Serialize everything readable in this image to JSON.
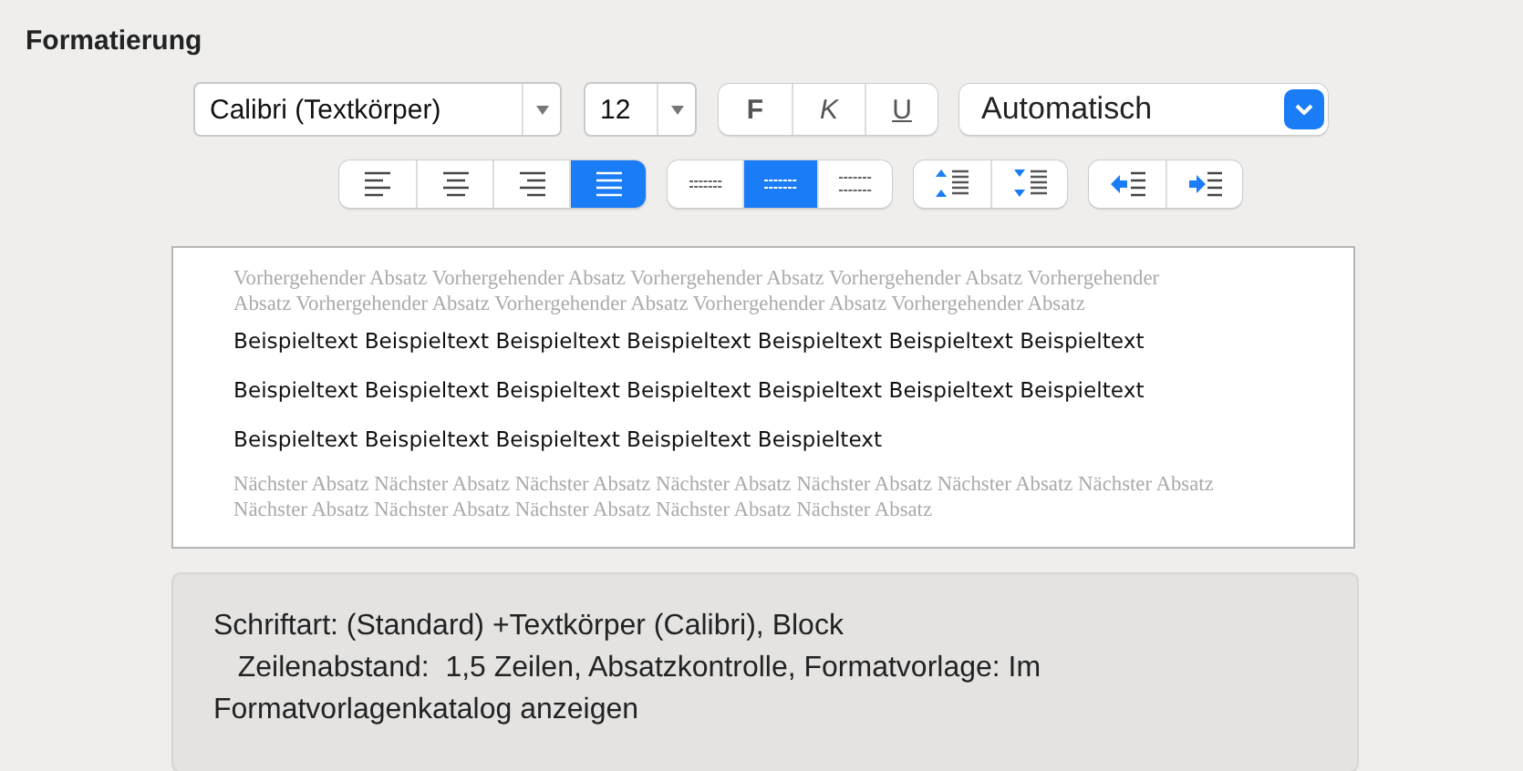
{
  "section_title": "Formatierung",
  "font_select": {
    "value": "Calibri (Textkörper)"
  },
  "size_select": {
    "value": "12"
  },
  "style_buttons": [
    {
      "label": "F",
      "kind": "bold",
      "selected": false
    },
    {
      "label": "K",
      "kind": "italic",
      "selected": false
    },
    {
      "label": "U",
      "kind": "underline",
      "selected": false
    }
  ],
  "color_select": {
    "value": "Automatisch"
  },
  "alignment": [
    {
      "kind": "left",
      "selected": false
    },
    {
      "kind": "center",
      "selected": false
    },
    {
      "kind": "right",
      "selected": false
    },
    {
      "kind": "justify",
      "selected": true
    }
  ],
  "line_spacing": [
    {
      "kind": "single",
      "selected": false
    },
    {
      "kind": "onehalf",
      "selected": true
    },
    {
      "kind": "double",
      "selected": false
    }
  ],
  "paragraph_spacing": [
    {
      "kind": "space-before"
    },
    {
      "kind": "space-after"
    }
  ],
  "indent": [
    {
      "kind": "decrease"
    },
    {
      "kind": "increase"
    }
  ],
  "preview": {
    "previous": "Vorhergehender Absatz Vorhergehender Absatz Vorhergehender Absatz Vorhergehender Absatz Vorhergehender Absatz Vorhergehender Absatz Vorhergehender Absatz Vorhergehender Absatz Vorhergehender Absatz",
    "sample": "Beispieltext Beispieltext Beispieltext Beispieltext Beispieltext Beispieltext Beispieltext Beispieltext Beispieltext Beispieltext Beispieltext Beispieltext Beispieltext Beispieltext Beispieltext Beispieltext Beispieltext Beispieltext Beispieltext",
    "next": "Nächster Absatz Nächster Absatz Nächster Absatz Nächster Absatz Nächster Absatz Nächster Absatz Nächster Absatz Nächster Absatz Nächster Absatz Nächster Absatz Nächster Absatz Nächster Absatz"
  },
  "description": "Schriftart: (Standard) +Textkörper (Calibri), Block\n   Zeilenabstand:  1,5 Zeilen, Absatzkontrolle, Formatvorlage: Im Formatvorlagenkatalog anzeigen"
}
